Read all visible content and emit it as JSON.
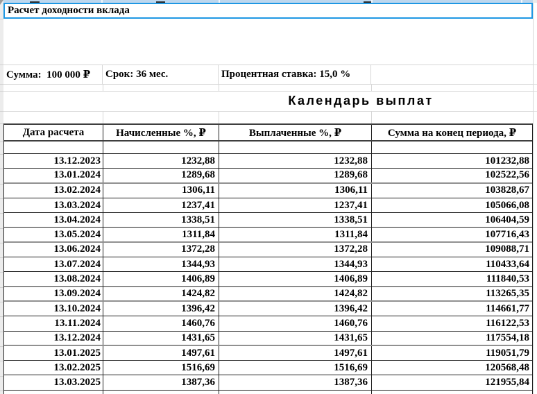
{
  "title_cell": "Расчет доходности вклада",
  "params": {
    "sum": "Сумма:  100 000 ₽",
    "term": "Срок: 36 мес.",
    "rate": "Процентная ставка: 15,0 %"
  },
  "section_title": "Календарь выплат",
  "table": {
    "headers": [
      "Дата расчета",
      "Начисленные %, ₽",
      "Выплаченные %, ₽",
      "Сумма на конец периода, ₽"
    ],
    "rows": [
      [
        "13.12.2023",
        "1232,88",
        "1232,88",
        "101232,88"
      ],
      [
        "13.01.2024",
        "1289,68",
        "1289,68",
        "102522,56"
      ],
      [
        "13.02.2024",
        "1306,11",
        "1306,11",
        "103828,67"
      ],
      [
        "13.03.2024",
        "1237,41",
        "1237,41",
        "105066,08"
      ],
      [
        "13.04.2024",
        "1338,51",
        "1338,51",
        "106404,59"
      ],
      [
        "13.05.2024",
        "1311,84",
        "1311,84",
        "107716,43"
      ],
      [
        "13.06.2024",
        "1372,28",
        "1372,28",
        "109088,71"
      ],
      [
        "13.07.2024",
        "1344,93",
        "1344,93",
        "110433,64"
      ],
      [
        "13.08.2024",
        "1406,89",
        "1406,89",
        "111840,53"
      ],
      [
        "13.09.2024",
        "1424,82",
        "1424,82",
        "113265,35"
      ],
      [
        "13.10.2024",
        "1396,42",
        "1396,42",
        "114661,77"
      ],
      [
        "13.11.2024",
        "1460,76",
        "1460,76",
        "116122,53"
      ],
      [
        "13.12.2024",
        "1431,65",
        "1431,65",
        "117554,18"
      ],
      [
        "13.01.2025",
        "1497,61",
        "1497,61",
        "119051,79"
      ],
      [
        "13.02.2025",
        "1516,69",
        "1516,69",
        "120568,48"
      ],
      [
        "13.03.2025",
        "1387,36",
        "1387,36",
        "121955,84"
      ]
    ]
  },
  "colors": {
    "selection_border": "#1e97e3",
    "top_strip_fill": "#bdd7ee",
    "gridline": "#d6d6d6"
  }
}
